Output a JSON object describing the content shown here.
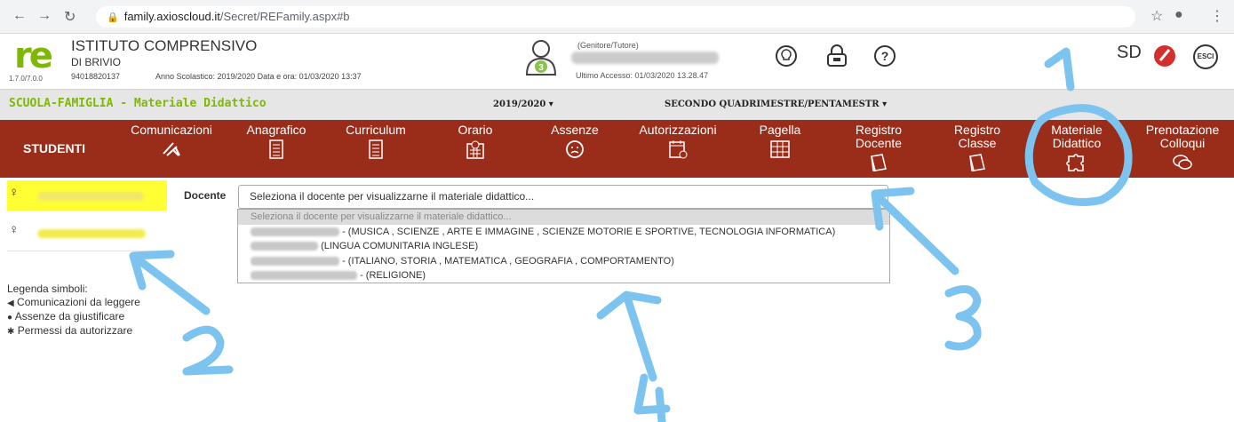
{
  "browser": {
    "url_domain": "family.axioscloud.it",
    "url_path": "/Secret/REFamily.aspx#b"
  },
  "header": {
    "logo": "re",
    "version": "1.7.0/7.0.0",
    "school_name": "ISTITUTO COMPRENSIVO",
    "school_sub": "DI BRIVIO",
    "school_code": "94018820137",
    "school_year_info": "Anno Scolastico: 2019/2020   Data e ora: 01/03/2020 13:37",
    "user_role": "(Genitore/Tutore)",
    "user_badge": "3",
    "last_access": "Ultimo Accesso: 01/03/2020 13.28.47",
    "sd_logo": "SD",
    "exit_label": "ESCI"
  },
  "title_row": {
    "title": "SCUOLA-FAMIGLIA - Materiale Didattico",
    "year": "2019/2020 ▾",
    "period": "SECONDO QUADRIMESTRE/PENTAMESTR ▾"
  },
  "nav": {
    "students": "STUDENTI",
    "items": [
      {
        "label": "Comunicazioni",
        "icon": "megaphone-icon"
      },
      {
        "label": "Anagrafico",
        "icon": "id-card-icon"
      },
      {
        "label": "Curriculum",
        "icon": "document-icon"
      },
      {
        "label": "Orario",
        "icon": "calendar-clock-icon"
      },
      {
        "label": "Assenze",
        "icon": "sad-face-icon"
      },
      {
        "label": "Autorizzazioni",
        "icon": "calendar-check-icon"
      },
      {
        "label": "Pagella",
        "icon": "report-card-icon"
      },
      {
        "label": "Registro\nDocente",
        "icon": "book-icon"
      },
      {
        "label": "Registro\nClasse",
        "icon": "book-icon"
      },
      {
        "label": "Materiale\nDidattico",
        "icon": "puzzle-icon"
      },
      {
        "label": "Prenotazione\nColloqui",
        "icon": "chat-icon"
      }
    ]
  },
  "students": {
    "gender_symbol": "♀"
  },
  "legend": {
    "title": "Legenda simboli:",
    "items": [
      {
        "icon": "megaphone-icon",
        "label": "Comunicazioni da leggere"
      },
      {
        "icon": "frown-icon",
        "label": "Assenze da giustificare"
      },
      {
        "icon": "paw-icon",
        "label": "Permessi da autorizzare"
      }
    ]
  },
  "docente": {
    "label": "Docente",
    "selected": "Seleziona il docente per visualizzarne il materiale didattico...",
    "options": [
      "Seleziona il docente per visualizzarne il materiale didattico...",
      "- (MUSICA , SCIENZE , ARTE E IMMAGINE , SCIENZE MOTORIE E SPORTIVE, TECNOLOGIA INFORMATICA)",
      "(LINGUA COMUNITARIA INGLESE)",
      "- (ITALIANO, STORIA , MATEMATICA , GEOGRAFIA , COMPORTAMENTO)",
      "- (RELIGIONE)"
    ]
  },
  "annotations": [
    "1",
    "2",
    "3",
    "4"
  ],
  "colors": {
    "nav_bg": "#9a2d1a",
    "brand_green": "#7fb800",
    "highlight": "#ffff33",
    "annotation": "#7cc4ef"
  }
}
